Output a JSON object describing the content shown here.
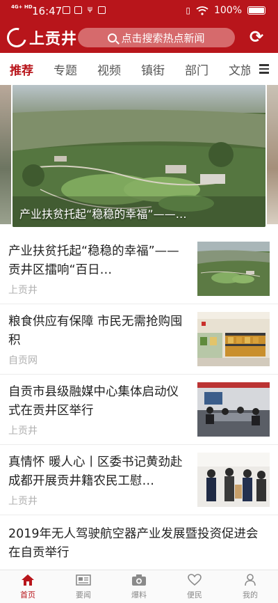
{
  "status_bar": {
    "network": "4G+ HD",
    "time": "16:47",
    "battery": "100%"
  },
  "header": {
    "logo_text": "上贡井",
    "search_placeholder": "点击搜索热点新闻",
    "icons": {
      "search": "search-icon",
      "refresh": "refresh-icon",
      "logo": "logo-mark-icon"
    }
  },
  "tabs": [
    {
      "label": "推荐",
      "active": true
    },
    {
      "label": "专题"
    },
    {
      "label": "视频"
    },
    {
      "label": "镇街"
    },
    {
      "label": "部门"
    },
    {
      "label": "文旅"
    }
  ],
  "banner": {
    "caption": "产业扶贫托起“稳稳的幸福”——…"
  },
  "news": [
    {
      "title": "产业扶贫托起“稳稳的幸福”——贡井区擂响“百日…",
      "source": "上贡井",
      "thumb": "aerial-farmland-photo"
    },
    {
      "title": "粮食供应有保障 市民无需抢购囤积",
      "source": "自贡网",
      "thumb": "supermarket-shelves-photo"
    },
    {
      "title": "自贡市县级融媒中心集体启动仪式在贡井区举行",
      "source": "上贡井",
      "thumb": "meeting-room-photo"
    },
    {
      "title": "真情怀 暖人心丨区委书记黄劲赴成都开展贡井籍农民工慰…",
      "source": "上贡井",
      "thumb": "people-gathering-photo"
    },
    {
      "title": "2019年无人驾驶航空器产业发展暨投资促进会在自贡举行"
    }
  ],
  "bottom_nav": [
    {
      "label": "首页",
      "icon": "home-icon",
      "active": true
    },
    {
      "label": "要闻",
      "icon": "newspaper-icon"
    },
    {
      "label": "爆料",
      "icon": "camera-icon"
    },
    {
      "label": "便民",
      "icon": "heart-icon"
    },
    {
      "label": "我的",
      "icon": "person-icon"
    }
  ],
  "colors": {
    "brand": "#b8151b",
    "muted": "#b0b0b0",
    "nav_inactive": "#8a8a8a"
  }
}
